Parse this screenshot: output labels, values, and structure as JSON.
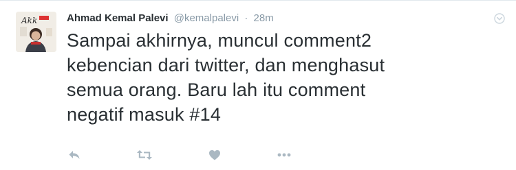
{
  "tweet": {
    "author_name": "Ahmad Kemal Palevi",
    "handle": "@kemalpalevi",
    "separator": "·",
    "time": "28m",
    "text_lines": [
      "Sampai akhirnya, muncul comment2",
      "kebencian dari twitter, dan menghasut",
      "semua orang. Baru lah itu comment",
      "negatif masuk #14"
    ]
  },
  "avatar": {
    "lettering": "AkK"
  },
  "icons": {
    "reply": "reply-icon",
    "retweet": "retweet-icon",
    "like": "heart-icon",
    "more": "more-icon",
    "caret": "chevron-down-icon"
  },
  "colors": {
    "name": "#292f33",
    "meta": "#8899a6",
    "action_icon": "#aab8c2",
    "border": "#e1e8ed"
  }
}
